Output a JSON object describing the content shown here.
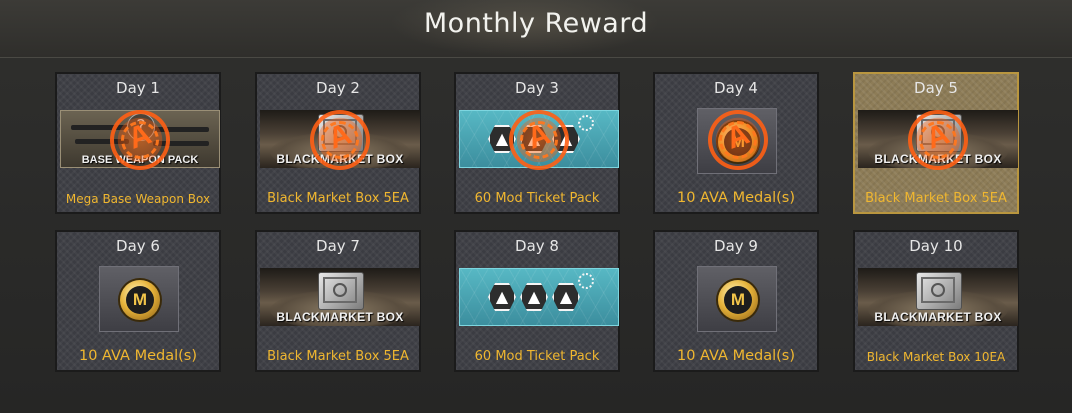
{
  "header": {
    "title": "Monthly Reward"
  },
  "accent_color": "#f0b730",
  "claimed_stamp_glyph": "A",
  "rewards": [
    {
      "day": "Day 1",
      "name": "Mega Base Weapon Box",
      "image": "weapon-pack",
      "image_label": "BASE WEAPON PACK",
      "claimed": true
    },
    {
      "day": "Day 2",
      "name": "Black Market Box 5EA",
      "image": "blackmarket-box",
      "image_label": "BLACKMARKET BOX",
      "claimed": true
    },
    {
      "day": "Day 3",
      "name": "60 Mod Ticket Pack",
      "image": "mod-ticket",
      "claimed": true
    },
    {
      "day": "Day 4",
      "name": "10 AVA Medal(s)",
      "image": "ava-medal",
      "medal_glyph": "M",
      "claimed": true
    },
    {
      "day": "Day 5",
      "name": "Black Market Box 5EA",
      "image": "blackmarket-box",
      "image_label": "BLACKMARKET BOX",
      "claimed": true,
      "highlighted": true
    },
    {
      "day": "Day 6",
      "name": "10 AVA Medal(s)",
      "image": "ava-medal",
      "medal_glyph": "M",
      "claimed": false
    },
    {
      "day": "Day 7",
      "name": "Black Market Box 5EA",
      "image": "blackmarket-box",
      "image_label": "BLACKMARKET BOX",
      "claimed": false
    },
    {
      "day": "Day 8",
      "name": "60 Mod Ticket Pack",
      "image": "mod-ticket",
      "claimed": false
    },
    {
      "day": "Day 9",
      "name": "10 AVA Medal(s)",
      "image": "ava-medal",
      "medal_glyph": "M",
      "claimed": false
    },
    {
      "day": "Day 10",
      "name": "Black Market Box 10EA",
      "image": "blackmarket-box",
      "image_label": "BLACKMARKET BOX",
      "claimed": false
    }
  ]
}
